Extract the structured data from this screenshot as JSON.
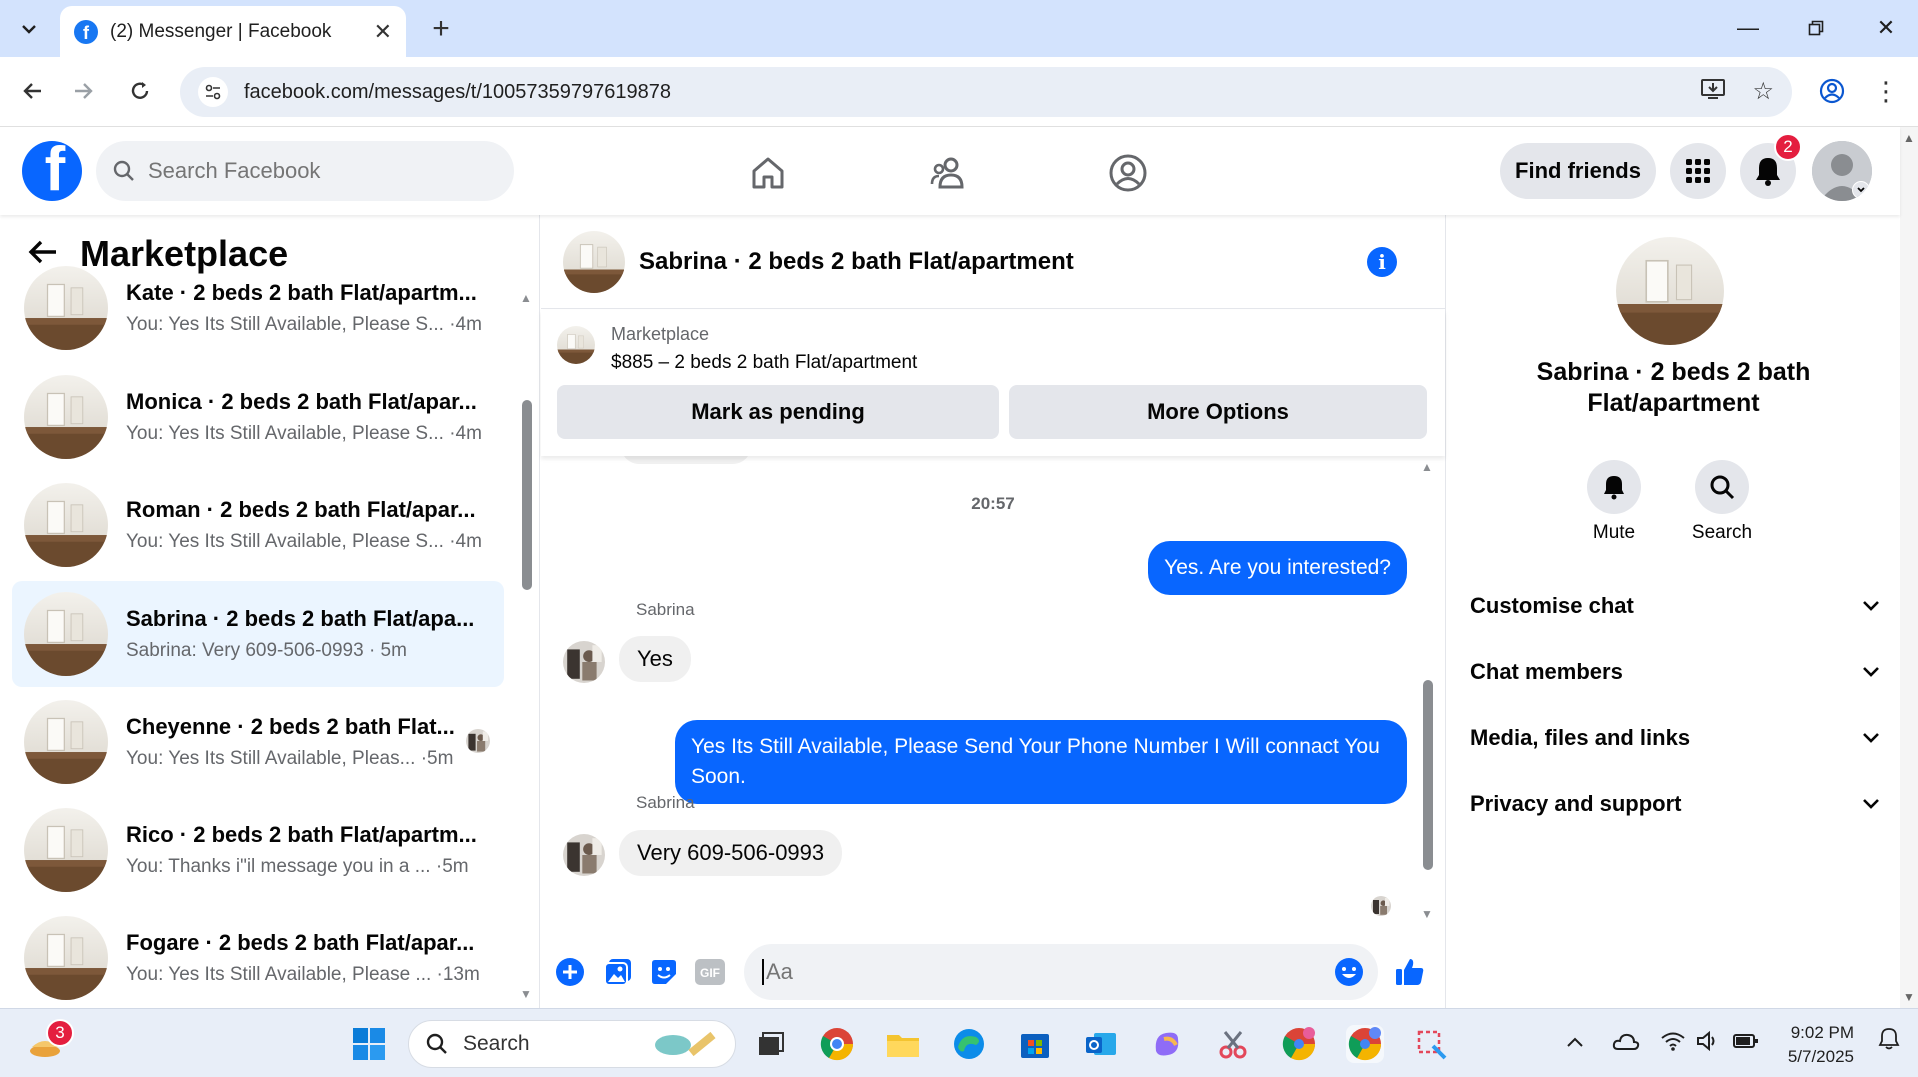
{
  "browser": {
    "tab_title": "(2) Messenger | Facebook",
    "url": "facebook.com/messages/t/10057359797619878"
  },
  "fb": {
    "search_placeholder": "Search Facebook",
    "find_friends": "Find friends",
    "notif_count": "2"
  },
  "left": {
    "title": "Marketplace",
    "conversations": [
      {
        "name": "Kate · 2 beds 2 bath Flat/apartm...",
        "preview": "You: Yes Its Still Available, Please S... ·4m"
      },
      {
        "name": "Monica · 2 beds 2 bath Flat/apar...",
        "preview": "You: Yes Its Still Available, Please S... ·4m"
      },
      {
        "name": "Roman · 2 beds 2 bath Flat/apar...",
        "preview": "You: Yes Its Still Available, Please S... ·4m"
      },
      {
        "name": "Sabrina · 2 beds 2 bath Flat/apa...",
        "preview": "Sabrina: Very 609-506-0993 · 5m"
      },
      {
        "name": "Cheyenne · 2 beds 2 bath Flat...",
        "preview": "You: Yes Its Still Available, Pleas... ·5m"
      },
      {
        "name": "Rico · 2 beds 2 bath Flat/apartm...",
        "preview": "You: Thanks i\"il message you in a ... ·5m"
      },
      {
        "name": "Fogare · 2 beds 2 bath Flat/apar...",
        "preview": "You: Yes Its Still Available, Please ... ·13m"
      }
    ]
  },
  "chat": {
    "title": "Sabrina · 2 beds 2 bath Flat/apartment",
    "marketplace_label": "Marketplace",
    "item": "$885 – 2 beds 2 bath Flat/apartment",
    "mark_pending": "Mark as pending",
    "more_options": "More Options",
    "timestamp": "20:57",
    "messages": [
      {
        "from": "me",
        "text": "Yes. Are you interested?"
      },
      {
        "from": "Sabrina",
        "text": "Yes"
      },
      {
        "from": "me",
        "text": "Yes Its Still Available, Please Send Your Phone Number I Will connact You Soon."
      },
      {
        "from": "Sabrina",
        "text": "Very 609-506-0993"
      }
    ],
    "composer_placeholder": "Aa"
  },
  "right": {
    "name": "Sabrina · 2 beds 2 bath Flat/apartment",
    "mute": "Mute",
    "search": "Search",
    "sections": [
      "Customise chat",
      "Chat members",
      "Media, files and links",
      "Privacy and support"
    ]
  },
  "taskbar": {
    "search": "Search",
    "time": "9:02 PM",
    "date": "5/7/2025",
    "widget_badge": "3"
  },
  "colors": {
    "accent": "#0866ff",
    "active_row": "#ebf5ff",
    "tab_strip": "#d3e3fd"
  }
}
